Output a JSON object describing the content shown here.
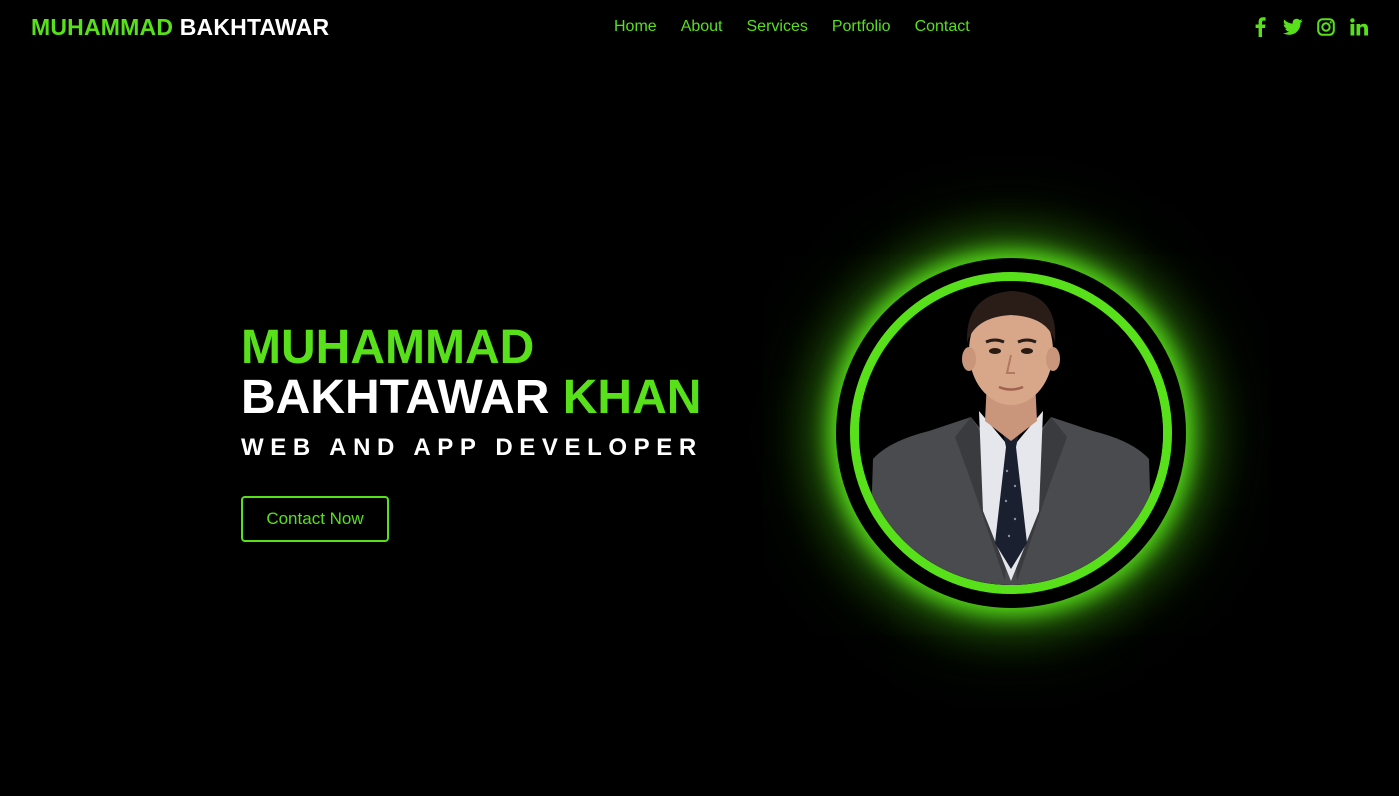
{
  "header": {
    "logo": {
      "first": "MUHAMMAD",
      "last": "BAKHTAWAR"
    },
    "nav": [
      "Home",
      "About",
      "Services",
      "Portfolio",
      "Contact"
    ],
    "social_icons": [
      "facebook-icon",
      "twitter-icon",
      "instagram-icon",
      "linkedin-icon"
    ]
  },
  "hero": {
    "name_line1": "MUHAMMAD",
    "name_line2_white": "BAKHTAWAR",
    "name_line2_green": "KHAN",
    "role": "WEB AND APP DEVELOPER",
    "cta_label": "Contact Now",
    "portrait_icon": "profile-photo"
  },
  "colors": {
    "accent": "#58e01a",
    "background": "#000000",
    "text": "#ffffff"
  }
}
